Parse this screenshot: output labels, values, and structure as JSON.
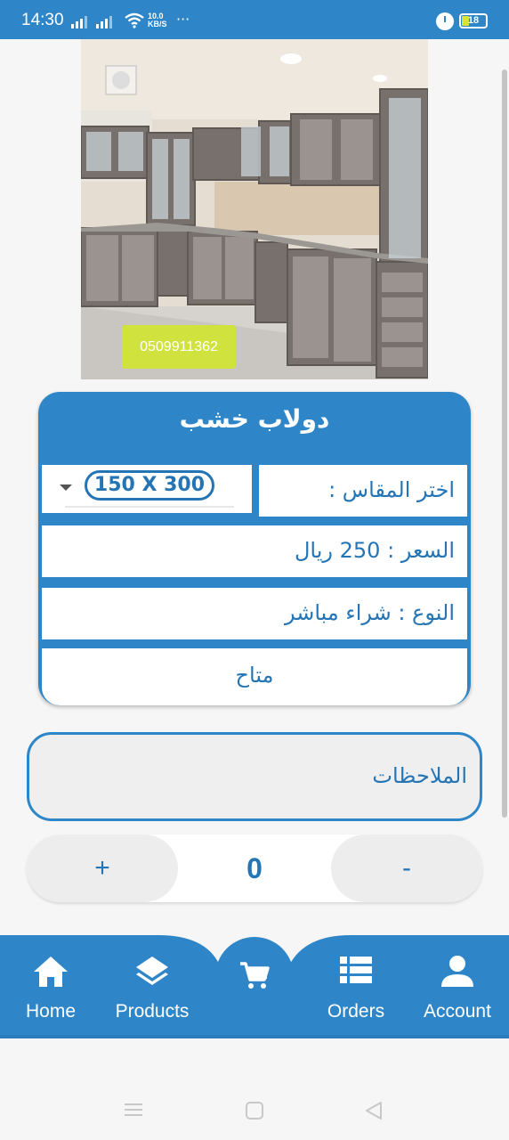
{
  "status_bar": {
    "time": "14:30",
    "net_speed_value": "10.0",
    "net_speed_unit": "KB/S",
    "more": "···",
    "battery": "18",
    "colors": {
      "background": "#2e86c8",
      "battery_fill": "#d8e430"
    }
  },
  "product": {
    "image_icon": "kitchen-cabinets-photo",
    "phone_tag": "0509911362",
    "title": "دولاب خشب",
    "size_label": "اختر المقاس :",
    "size_value": "150 X 300",
    "price": "السعر : 250 ريال",
    "type": "النوع : شراء مباشر",
    "availability": "متاح"
  },
  "notes": {
    "label": "الملاحظات"
  },
  "quantity": {
    "plus": "+",
    "value": "0",
    "minus": "-"
  },
  "bottom_nav": {
    "items": [
      {
        "label": "Home",
        "icon": "home-icon"
      },
      {
        "label": "Products",
        "icon": "layers-icon"
      },
      {
        "label": "",
        "icon": "cart-icon"
      },
      {
        "label": "Orders",
        "icon": "list-icon"
      },
      {
        "label": "Account",
        "icon": "person-icon"
      }
    ]
  },
  "colors": {
    "primary": "#2e86c8",
    "text_blue": "#2575b5",
    "tag_green": "#cfe23e"
  }
}
